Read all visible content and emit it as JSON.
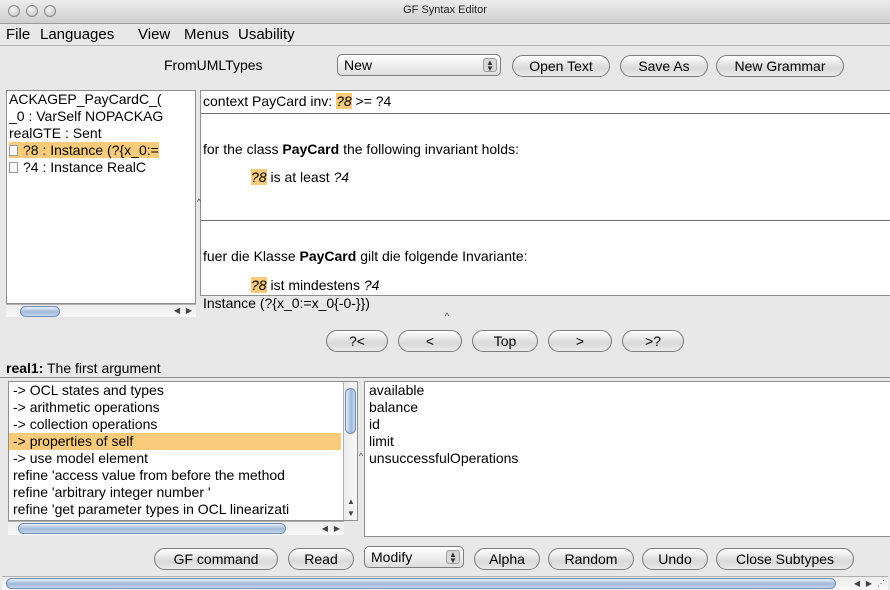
{
  "window": {
    "title": "GF Syntax Editor"
  },
  "menubar": {
    "items": [
      "File",
      "Languages",
      "View",
      "Menus",
      "Usability"
    ]
  },
  "toolbar": {
    "module_label": "FromUMLTypes",
    "select_value": "New",
    "open_text": "Open Text",
    "save_as": "Save As",
    "new_grammar": "New Grammar"
  },
  "tree": {
    "lines": [
      "ACKAGEP_PayCardC_(",
      "_0 : VarSelf NOPACKAG",
      "realGTE : Sent",
      "?8 : Instance (?{x_0:=",
      "?4 : Instance RealC"
    ],
    "status": "Instance (?{x_0:=x_0{-0-}})"
  },
  "editor": {
    "ocl": {
      "prefix": "context PayCard inv: ",
      "meta": "?8",
      "suffix": " >= ?4"
    },
    "english": {
      "l1_a": "for the class ",
      "l1_b": "PayCard",
      "l1_c": " the following invariant holds:",
      "l2_meta": "?8",
      "l2_text": " is at least ",
      "l2_var": "?4"
    },
    "german": {
      "l1_a": "fuer die Klasse ",
      "l1_b": "PayCard",
      "l1_c": " gilt die folgende Invariante:",
      "l2_meta": "?8",
      "l2_text": " ist mindestens ",
      "l2_var": "?4"
    }
  },
  "nav": {
    "prev_meta": "?<",
    "prev": "<",
    "top": "Top",
    "next": ">",
    "next_meta": ">?"
  },
  "info": {
    "bold": "real1:",
    "text": " The first argument"
  },
  "refine_list": [
    "-> OCL states and types",
    "-> arithmetic operations",
    "-> collection operations",
    "-> properties of self",
    "-> use model element",
    "refine 'access value from before the method",
    "refine 'arbitrary integer number '",
    "refine 'get parameter types in OCL linearizati"
  ],
  "attr_list": [
    "available",
    "balance",
    "id",
    "limit",
    "unsuccessfulOperations"
  ],
  "bottom": {
    "gf_command": "GF command",
    "read": "Read",
    "modify": "Modify",
    "alpha": "Alpha",
    "random": "Random",
    "undo": "Undo",
    "close_subtypes": "Close Subtypes"
  },
  "colors": {
    "selection": "#f9cb7a",
    "scroll_thumb": "#9fb8d8"
  }
}
